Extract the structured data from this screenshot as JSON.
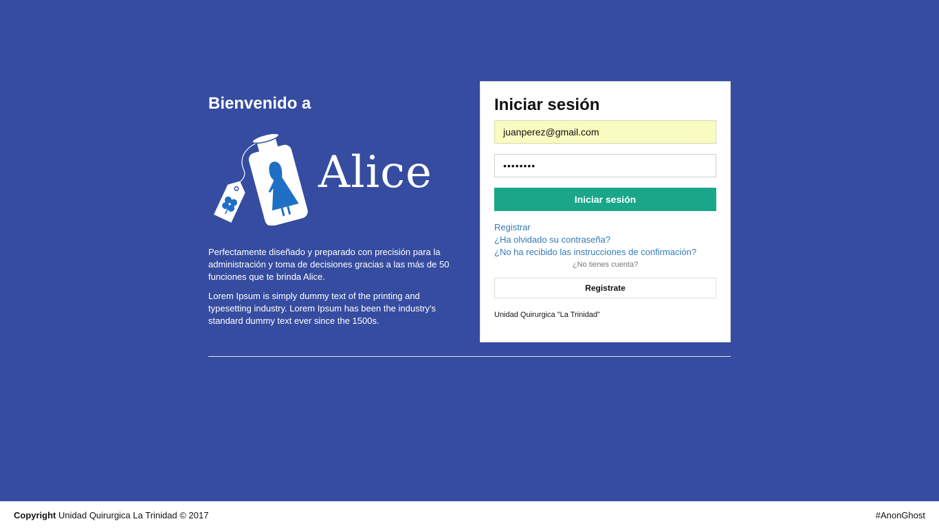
{
  "welcome": {
    "title": "Bienvenido a",
    "logo_text": "Alice",
    "paragraph_1": "Perfectamente diseñado y preparado con precisión para la administración y toma de decisiones gracias a las más de 50 funciones que te brinda Alice.",
    "paragraph_2": "Lorem Ipsum is simply dummy text of the printing and typesetting industry. Lorem Ipsum has been the industry's standard dummy text ever since the 1500s."
  },
  "login": {
    "title": "Iniciar sesión",
    "email_value": "juanperez@gmail.com",
    "password_mask": "••••••••",
    "submit_label": "Iniciar sesión",
    "links": [
      "Registrar",
      "¿Ha olvidado su contraseña?",
      "¿No ha recibido las instrucciones de confirmación?"
    ],
    "no_account_text": "¿No tienes cuenta?",
    "register_button_label": "Registrate",
    "footer_text": "Unidad Quirurgica \"La Trinidad\""
  },
  "footer": {
    "copyright_label": "Copyright",
    "copyright_text": "Unidad Quirurgica La Trinidad © 2017",
    "right_text": "#AnonGhost"
  },
  "colors": {
    "background": "#364ca0",
    "primary_button": "#19a689",
    "link": "#337ab7",
    "logo_figure": "#1f6fc4"
  },
  "icons": [
    "alice-bottle-logo-icon",
    "clover-tag-icon"
  ]
}
